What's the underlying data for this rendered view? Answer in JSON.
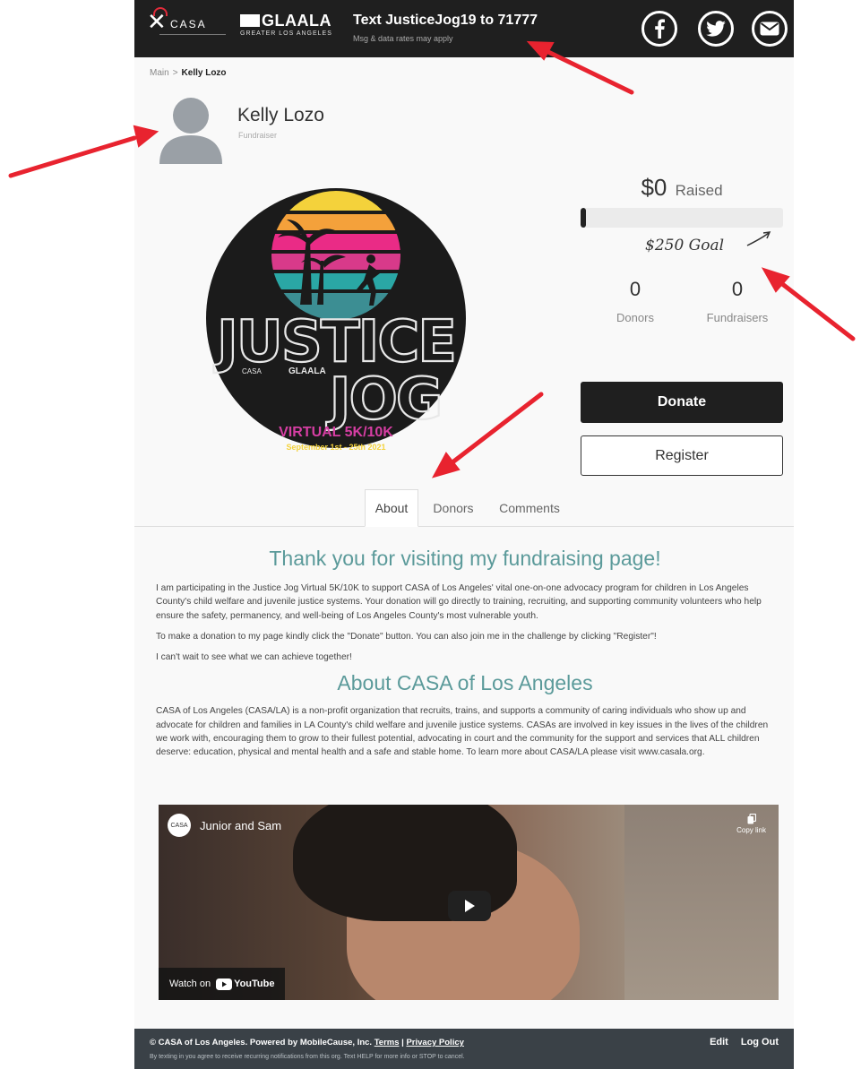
{
  "header": {
    "casa_logo_text": "CASA",
    "glaala_logo_text": "GLAALA",
    "glaala_sub": "GREATER LOS ANGELES",
    "text_cta": "Text JusticeJog19 to 71777",
    "text_note": "Msg & data rates may apply",
    "social_icons": [
      "facebook-icon",
      "twitter-icon",
      "email-icon"
    ]
  },
  "breadcrumb": {
    "root": "Main",
    "separator": ">",
    "current": "Kelly Lozo"
  },
  "profile": {
    "name": "Kelly Lozo",
    "role": "Fundraiser"
  },
  "badge": {
    "line1": "JUSTICE",
    "line2": "JOG",
    "event": "VIRTUAL 5K/10K",
    "dates": "September 1st - 25th 2021",
    "casa_text": "CASA",
    "glaala_text": "GLAALA"
  },
  "stats": {
    "raised_amount": "$0",
    "raised_label": "Raised",
    "progress_fraction": 0.02,
    "goal": "$250 Goal",
    "donors_count": "0",
    "donors_label": "Donors",
    "fundraisers_count": "0",
    "fundraisers_label": "Fundraisers"
  },
  "actions": {
    "donate": "Donate",
    "register": "Register"
  },
  "tabs": [
    "About",
    "Donors",
    "Comments"
  ],
  "content": {
    "heading1": "Thank you for visiting my fundraising page!",
    "para1": "I am participating in the Justice Jog Virtual 5K/10K to support CASA of Los Angeles' vital one-on-one advocacy program for children in Los Angeles County's child welfare and juvenile justice systems. Your donation will go directly to training, recruiting, and supporting community volunteers who help ensure the safety, permanency, and well-being of Los Angeles County's most vulnerable youth.",
    "para2": "To make a donation to my page kindly click the \"Donate\" button. You can also join me in the challenge by clicking \"Register\"!",
    "para3": "I can't wait to see what we can achieve together!",
    "heading2": "About CASA of Los Angeles",
    "para4": "CASA of Los Angeles (CASA/LA) is a non-profit organization that recruits, trains, and supports a community of caring individuals who show up and advocate for children and families in LA County's child welfare and juvenile justice systems. CASAs are involved in key issues in the lives of the children we work with, encouraging them to grow to their fullest potential, advocating in court and the community for the support and services that ALL children deserve: education, physical and mental health and a safe and stable home. To learn more about CASA/LA please visit www.casala.org."
  },
  "video": {
    "title": "Junior and Sam",
    "copy_link": "Copy link",
    "watch_on": "Watch on",
    "youtube": "YouTube",
    "channel_logo": "CASA"
  },
  "footer": {
    "copyright": "© CASA of Los Angeles. Powered by MobileCause, Inc.",
    "terms": "Terms",
    "divider": "|",
    "privacy": "Privacy Policy",
    "notice": "By texting in you agree to receive recurring notifications from this org. Text HELP for more info or STOP to cancel.",
    "edit": "Edit",
    "logout": "Log Out"
  },
  "colors": {
    "header_bg": "#1f1f1f",
    "accent_teal": "#5b9a9a",
    "donate_bg": "#1f1f1f",
    "footer_bg": "#3a4147",
    "annotation_arrow": "#e8232f"
  }
}
